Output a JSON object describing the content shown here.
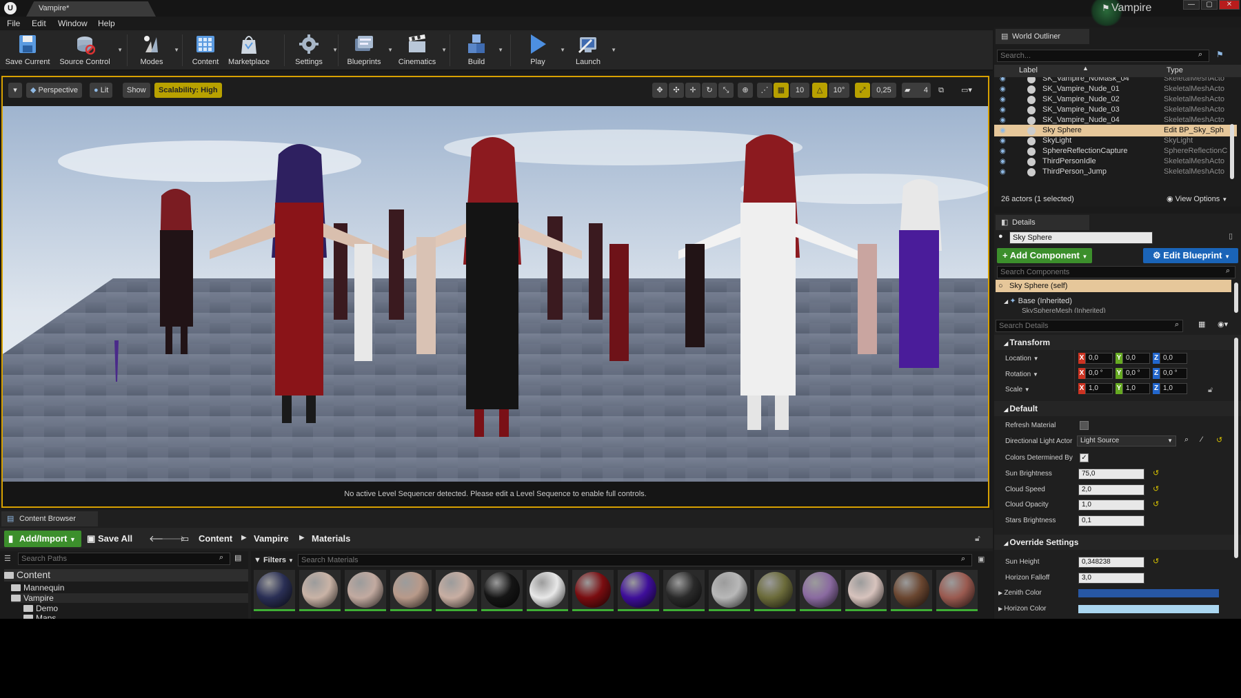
{
  "window": {
    "doc_tab": "Vampire*",
    "project": "Vampire",
    "controls": {
      "minimize": "—",
      "maximize": "▢",
      "close": "✕"
    }
  },
  "menu": [
    "File",
    "Edit",
    "Window",
    "Help"
  ],
  "toolbar": {
    "save_current": "Save Current",
    "source_control": "Source Control",
    "modes": "Modes",
    "content": "Content",
    "marketplace": "Marketplace",
    "settings": "Settings",
    "blueprints": "Blueprints",
    "cinematics": "Cinematics",
    "build": "Build",
    "play": "Play",
    "launch": "Launch"
  },
  "viewport": {
    "perspective": "Perspective",
    "lit": "Lit",
    "show": "Show",
    "scalability": "Scalability: High",
    "grid_snap": "10",
    "rotation_snap": "10°",
    "scale_snap": "0,25",
    "camera_speed": "4",
    "footer": "No active Level Sequencer detected. Please edit a Level Sequence to enable full controls."
  },
  "content_browser": {
    "tab": "Content Browser",
    "add_import": "Add/Import",
    "save_all": "Save All",
    "breadcrumbs": [
      "Content",
      "Vampire",
      "Materials"
    ],
    "search_paths": "Search Paths",
    "filters": "Filters",
    "search_materials": "Search Materials",
    "tree": [
      "Content",
      "Mannequin",
      "Vampire",
      "Demo",
      "Maps"
    ],
    "asset_colors": [
      "#2a2f55",
      "#c9b3a6",
      "#c2aaa0",
      "#b89a8a",
      "#c8aea2",
      "#151515",
      "#e8e8e8",
      "#7a0d10",
      "#3e0e9a",
      "#2a2a2a",
      "#b8b8b8",
      "#6b6b3a",
      "#8a6aa0",
      "#d7c3bd",
      "#6a4630",
      "#9a5a50"
    ]
  },
  "world_outliner": {
    "tab": "World Outliner",
    "search_placeholder": "Search...",
    "col_label": "Label",
    "col_type": "Type",
    "rows": [
      {
        "label": "SK_Vampire_NoMask_04",
        "type": "SkeletalMeshActo"
      },
      {
        "label": "SK_Vampire_Nude_01",
        "type": "SkeletalMeshActo"
      },
      {
        "label": "SK_Vampire_Nude_02",
        "type": "SkeletalMeshActo"
      },
      {
        "label": "SK_Vampire_Nude_03",
        "type": "SkeletalMeshActo"
      },
      {
        "label": "SK_Vampire_Nude_04",
        "type": "SkeletalMeshActo"
      },
      {
        "label": "Sky Sphere",
        "type": "Edit BP_Sky_Sph"
      },
      {
        "label": "SkyLight",
        "type": "SkyLight"
      },
      {
        "label": "SphereReflectionCapture",
        "type": "SphereReflectionC"
      },
      {
        "label": "ThirdPersonIdle",
        "type": "SkeletalMeshActo"
      },
      {
        "label": "ThirdPerson_Jump",
        "type": "SkeletalMeshActo"
      }
    ],
    "footer": "26 actors (1 selected)",
    "view_options": "View Options"
  },
  "details": {
    "tab": "Details",
    "object_name": "Sky Sphere",
    "add_component": "Add Component",
    "edit_blueprint": "Edit Blueprint",
    "search_components": "Search Components",
    "component_self": "Sky Sphere (self)",
    "component_base": "Base (Inherited)",
    "component_mesh": "SkySphereMesh (Inherited)",
    "search_details": "Search Details",
    "transform": {
      "title": "Transform",
      "location_label": "Location",
      "rotation_label": "Rotation",
      "scale_label": "Scale",
      "location": [
        "0,0",
        "0,0",
        "0,0"
      ],
      "rotation": [
        "0,0 °",
        "0,0 °",
        "0,0 °"
      ],
      "scale": [
        "1,0",
        "1,0",
        "1,0"
      ]
    },
    "default": {
      "title": "Default",
      "refresh_material": "Refresh Material",
      "directional_light": "Directional Light Actor",
      "light_source": "Light Source",
      "colors_determined": "Colors Determined By",
      "sun_brightness": "Sun Brightness",
      "sun_brightness_val": "75,0",
      "cloud_speed": "Cloud Speed",
      "cloud_speed_val": "2,0",
      "cloud_opacity": "Cloud Opacity",
      "cloud_opacity_val": "1,0",
      "stars_brightness": "Stars Brightness",
      "stars_brightness_val": "0,1"
    },
    "override": {
      "title": "Override Settings",
      "sun_height": "Sun Height",
      "sun_height_val": "0,348238",
      "horizon_falloff": "Horizon Falloff",
      "horizon_falloff_val": "3,0",
      "zenith_color": "Zenith Color",
      "zenith_color_hex": "#2757a4",
      "horizon_color": "Horizon Color",
      "horizon_color_hex": "#aad6f0"
    }
  },
  "colors": {
    "accent_green": "#3c8f2c",
    "accent_blue": "#1a64b8",
    "viewport_border": "#d8a100",
    "selection": "#e6c79a"
  }
}
